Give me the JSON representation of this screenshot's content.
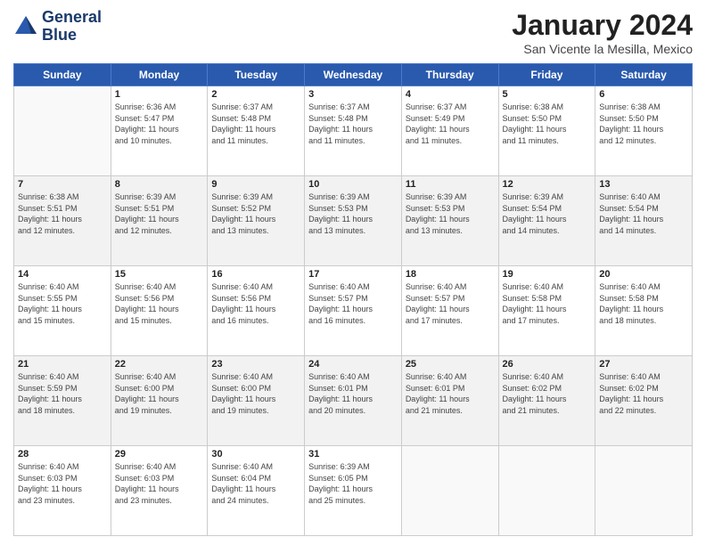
{
  "logo": {
    "line1": "General",
    "line2": "Blue"
  },
  "title": "January 2024",
  "subtitle": "San Vicente la Mesilla, Mexico",
  "days_header": [
    "Sunday",
    "Monday",
    "Tuesday",
    "Wednesday",
    "Thursday",
    "Friday",
    "Saturday"
  ],
  "weeks": [
    [
      {
        "day": "",
        "info": ""
      },
      {
        "day": "1",
        "info": "Sunrise: 6:36 AM\nSunset: 5:47 PM\nDaylight: 11 hours\nand 10 minutes."
      },
      {
        "day": "2",
        "info": "Sunrise: 6:37 AM\nSunset: 5:48 PM\nDaylight: 11 hours\nand 11 minutes."
      },
      {
        "day": "3",
        "info": "Sunrise: 6:37 AM\nSunset: 5:48 PM\nDaylight: 11 hours\nand 11 minutes."
      },
      {
        "day": "4",
        "info": "Sunrise: 6:37 AM\nSunset: 5:49 PM\nDaylight: 11 hours\nand 11 minutes."
      },
      {
        "day": "5",
        "info": "Sunrise: 6:38 AM\nSunset: 5:50 PM\nDaylight: 11 hours\nand 11 minutes."
      },
      {
        "day": "6",
        "info": "Sunrise: 6:38 AM\nSunset: 5:50 PM\nDaylight: 11 hours\nand 12 minutes."
      }
    ],
    [
      {
        "day": "7",
        "info": "Sunrise: 6:38 AM\nSunset: 5:51 PM\nDaylight: 11 hours\nand 12 minutes."
      },
      {
        "day": "8",
        "info": "Sunrise: 6:39 AM\nSunset: 5:51 PM\nDaylight: 11 hours\nand 12 minutes."
      },
      {
        "day": "9",
        "info": "Sunrise: 6:39 AM\nSunset: 5:52 PM\nDaylight: 11 hours\nand 13 minutes."
      },
      {
        "day": "10",
        "info": "Sunrise: 6:39 AM\nSunset: 5:53 PM\nDaylight: 11 hours\nand 13 minutes."
      },
      {
        "day": "11",
        "info": "Sunrise: 6:39 AM\nSunset: 5:53 PM\nDaylight: 11 hours\nand 13 minutes."
      },
      {
        "day": "12",
        "info": "Sunrise: 6:39 AM\nSunset: 5:54 PM\nDaylight: 11 hours\nand 14 minutes."
      },
      {
        "day": "13",
        "info": "Sunrise: 6:40 AM\nSunset: 5:54 PM\nDaylight: 11 hours\nand 14 minutes."
      }
    ],
    [
      {
        "day": "14",
        "info": "Sunrise: 6:40 AM\nSunset: 5:55 PM\nDaylight: 11 hours\nand 15 minutes."
      },
      {
        "day": "15",
        "info": "Sunrise: 6:40 AM\nSunset: 5:56 PM\nDaylight: 11 hours\nand 15 minutes."
      },
      {
        "day": "16",
        "info": "Sunrise: 6:40 AM\nSunset: 5:56 PM\nDaylight: 11 hours\nand 16 minutes."
      },
      {
        "day": "17",
        "info": "Sunrise: 6:40 AM\nSunset: 5:57 PM\nDaylight: 11 hours\nand 16 minutes."
      },
      {
        "day": "18",
        "info": "Sunrise: 6:40 AM\nSunset: 5:57 PM\nDaylight: 11 hours\nand 17 minutes."
      },
      {
        "day": "19",
        "info": "Sunrise: 6:40 AM\nSunset: 5:58 PM\nDaylight: 11 hours\nand 17 minutes."
      },
      {
        "day": "20",
        "info": "Sunrise: 6:40 AM\nSunset: 5:58 PM\nDaylight: 11 hours\nand 18 minutes."
      }
    ],
    [
      {
        "day": "21",
        "info": "Sunrise: 6:40 AM\nSunset: 5:59 PM\nDaylight: 11 hours\nand 18 minutes."
      },
      {
        "day": "22",
        "info": "Sunrise: 6:40 AM\nSunset: 6:00 PM\nDaylight: 11 hours\nand 19 minutes."
      },
      {
        "day": "23",
        "info": "Sunrise: 6:40 AM\nSunset: 6:00 PM\nDaylight: 11 hours\nand 19 minutes."
      },
      {
        "day": "24",
        "info": "Sunrise: 6:40 AM\nSunset: 6:01 PM\nDaylight: 11 hours\nand 20 minutes."
      },
      {
        "day": "25",
        "info": "Sunrise: 6:40 AM\nSunset: 6:01 PM\nDaylight: 11 hours\nand 21 minutes."
      },
      {
        "day": "26",
        "info": "Sunrise: 6:40 AM\nSunset: 6:02 PM\nDaylight: 11 hours\nand 21 minutes."
      },
      {
        "day": "27",
        "info": "Sunrise: 6:40 AM\nSunset: 6:02 PM\nDaylight: 11 hours\nand 22 minutes."
      }
    ],
    [
      {
        "day": "28",
        "info": "Sunrise: 6:40 AM\nSunset: 6:03 PM\nDaylight: 11 hours\nand 23 minutes."
      },
      {
        "day": "29",
        "info": "Sunrise: 6:40 AM\nSunset: 6:03 PM\nDaylight: 11 hours\nand 23 minutes."
      },
      {
        "day": "30",
        "info": "Sunrise: 6:40 AM\nSunset: 6:04 PM\nDaylight: 11 hours\nand 24 minutes."
      },
      {
        "day": "31",
        "info": "Sunrise: 6:39 AM\nSunset: 6:05 PM\nDaylight: 11 hours\nand 25 minutes."
      },
      {
        "day": "",
        "info": ""
      },
      {
        "day": "",
        "info": ""
      },
      {
        "day": "",
        "info": ""
      }
    ]
  ]
}
